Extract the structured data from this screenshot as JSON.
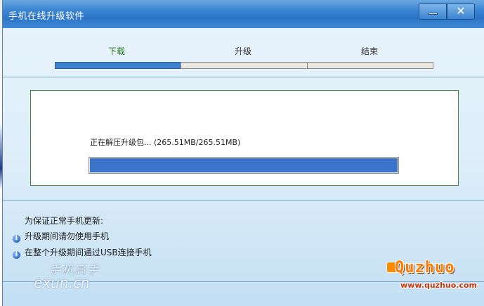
{
  "window": {
    "title": "手机在线升级软件",
    "minimize_label": "",
    "close_label": "✕"
  },
  "steps": [
    {
      "label": "下载",
      "state": "active"
    },
    {
      "label": "升级",
      "state": "pending"
    },
    {
      "label": "结束",
      "state": "pending"
    }
  ],
  "status": {
    "text": "正在解压升级包...  (265.51MB/265.51MB)",
    "progress": 1.0
  },
  "notes": {
    "title": "为保证正常手机更新:",
    "items": [
      "升级期间请勿使用手机",
      "在整个升级期间通过USB连接手机"
    ]
  },
  "watermarks": {
    "left_top": "手机高手",
    "left_bottom": "exun.cn",
    "right_brand": "Quzhuo",
    "right_url": "www.quzhuo.com"
  },
  "colors": {
    "titlebar": "#2d74c6",
    "active_step": "#2a7a1a",
    "progress_fill": "#3a73c9",
    "panel_border": "#3c8a3c"
  }
}
